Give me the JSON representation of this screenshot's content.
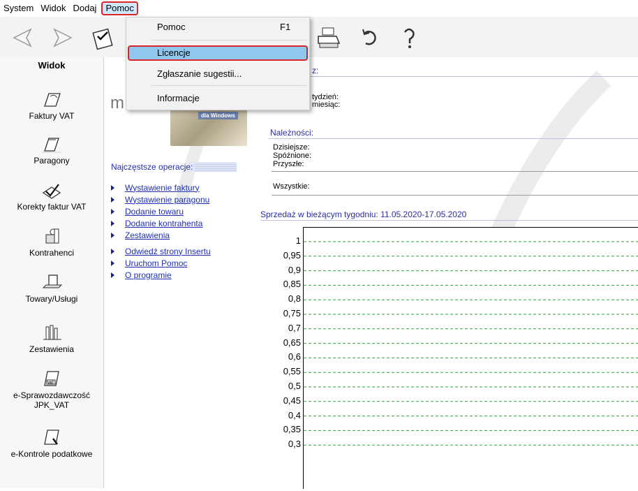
{
  "menubar": {
    "items": [
      "System",
      "Widok",
      "Dodaj",
      "Pomoc"
    ]
  },
  "toolbar": {
    "buttons": [
      "back-arrow-icon",
      "forward-arrow-icon",
      "checklist-icon",
      "printer-icon",
      "refresh-icon",
      "help-icon"
    ]
  },
  "sidebar": {
    "title": "Widok",
    "items": [
      {
        "label": "Faktury VAT",
        "icon": "invoice-icon"
      },
      {
        "label": "Paragony",
        "icon": "receipt-icon"
      },
      {
        "label": "Korekty faktur VAT",
        "icon": "correction-icon"
      },
      {
        "label": "Kontrahenci",
        "icon": "contractors-icon"
      },
      {
        "label": "Towary/Usługi",
        "icon": "goods-icon"
      },
      {
        "label": "Zestawienia",
        "icon": "reports-icon"
      },
      {
        "label": "e-Sprawozdawczość JPK_VAT",
        "icon": "jpk-vat-icon"
      },
      {
        "label": "e-Kontrole podatkowe",
        "icon": "tax-control-icon"
      }
    ]
  },
  "middle": {
    "logo_text": "m",
    "logo_badge": "dla Windows",
    "ops_title": "Najczęstsze operacje:",
    "ops": [
      "Wystawienie faktury",
      "Wystawienie paragonu",
      "Dodanie towaru",
      "Dodanie kontrahenta",
      "Zestawienia"
    ],
    "links": [
      "Odwiedź strony Insertu",
      "Uruchom Pomoc",
      "O programie"
    ]
  },
  "right": {
    "section1_title": "z:",
    "section1_rows": [
      "tydzień:",
      "miesiąc:"
    ],
    "section2_title": "Należności:",
    "section2_rows": [
      "Dzisiejsze:",
      "Spóźnione:",
      "Przyszłe:"
    ],
    "all_label": "Wszystkie:",
    "chart_title": "Sprzedaż w bieżącym tygodniu: 11.05.2020-17.05.2020"
  },
  "chart_data": {
    "type": "line",
    "title": "Sprzedaż w bieżącym tygodniu: 11.05.2020-17.05.2020",
    "ytick_labels": [
      "1",
      "0,95",
      "0,9",
      "0,85",
      "0,8",
      "0,75",
      "0,7",
      "0,65",
      "0,6",
      "0,55",
      "0,5",
      "0,45",
      "0,4",
      "0,35",
      "0,3"
    ],
    "yticks": [
      1,
      0.95,
      0.9,
      0.85,
      0.8,
      0.75,
      0.7,
      0.65,
      0.6,
      0.55,
      0.5,
      0.45,
      0.4,
      0.35,
      0.3
    ],
    "grid": true,
    "grid_color": "#2e9e3a",
    "series": []
  },
  "dropdown": {
    "items": [
      {
        "label": "Pomoc",
        "shortcut": "F1"
      },
      {
        "label": "Licencje",
        "shortcut": ""
      },
      {
        "label": "Zgłaszanie sugestii...",
        "shortcut": ""
      },
      {
        "label": "Informacje",
        "shortcut": ""
      }
    ]
  },
  "colors": {
    "highlight": "#8fc7ef",
    "highlight_border": "#d9242a",
    "link": "#1f2fb0",
    "section_title": "#2a2fa3"
  }
}
